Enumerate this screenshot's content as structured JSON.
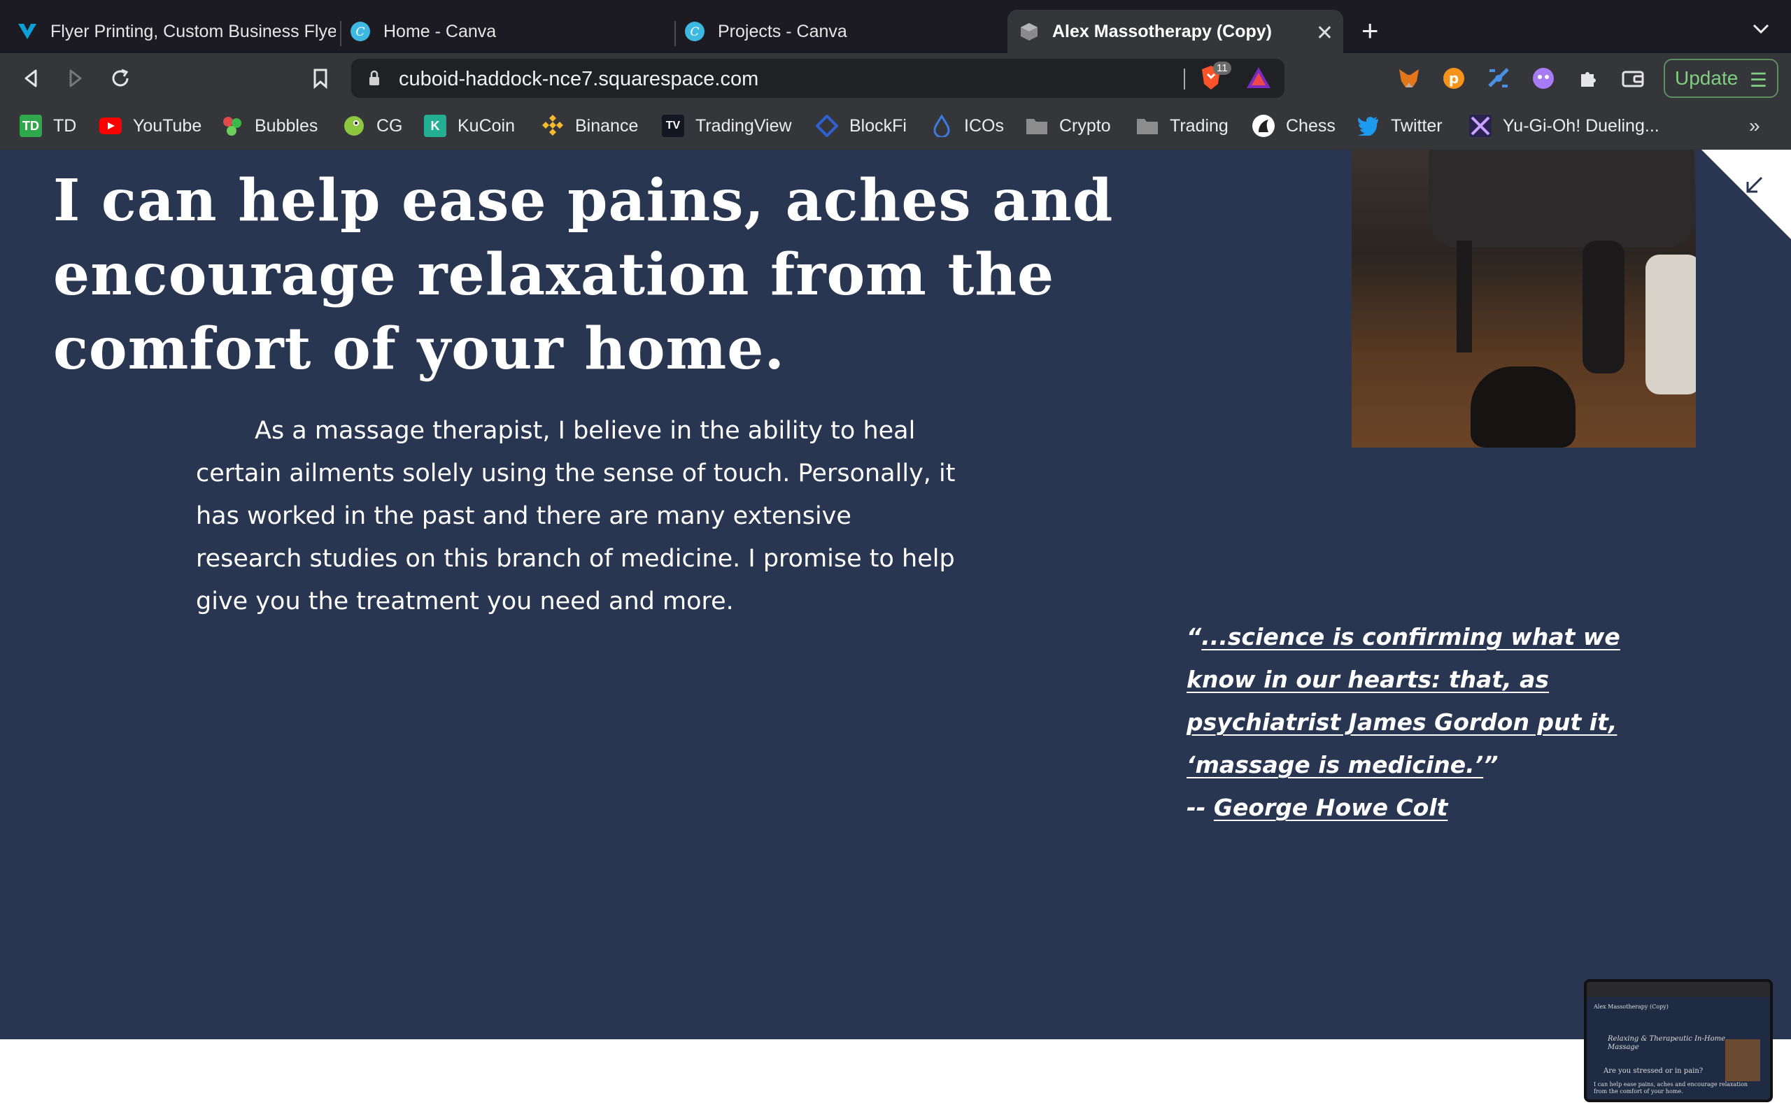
{
  "browser": {
    "tabs": [
      {
        "title": "Flyer Printing, Custom Business Flye",
        "icon": "vistaprint-icon"
      },
      {
        "title": "Home - Canva",
        "icon": "canva-icon"
      },
      {
        "title": "Projects - Canva",
        "icon": "canva-icon"
      },
      {
        "title": "Alex Massotherapy (Copy)",
        "icon": "squarespace-cube-icon",
        "active": true
      }
    ],
    "url": "cuboid-haddock-nce7.squarespace.com",
    "brave_shield_count": "11",
    "update_label": "Update",
    "bookmarks": [
      {
        "label": "TD",
        "icon": "td-icon"
      },
      {
        "label": "YouTube",
        "icon": "youtube-icon"
      },
      {
        "label": "Bubbles",
        "icon": "bubbles-icon"
      },
      {
        "label": "CG",
        "icon": "coingecko-icon"
      },
      {
        "label": "KuCoin",
        "icon": "kucoin-icon"
      },
      {
        "label": "Binance",
        "icon": "binance-icon"
      },
      {
        "label": "TradingView",
        "icon": "tradingview-icon"
      },
      {
        "label": "BlockFi",
        "icon": "blockfi-icon"
      },
      {
        "label": "ICOs",
        "icon": "drop-icon"
      },
      {
        "label": "Crypto",
        "icon": "folder-icon"
      },
      {
        "label": "Trading",
        "icon": "folder-icon"
      },
      {
        "label": "Chess",
        "icon": "chess-icon"
      },
      {
        "label": "Twitter",
        "icon": "twitter-icon"
      },
      {
        "label": "Yu-Gi-Oh! Dueling...",
        "icon": "yugioh-icon"
      }
    ],
    "bookmarks_more": "»"
  },
  "page": {
    "headline": "I can help ease pains, aches and encourage relaxation from the comfort of your home.",
    "body": "As a massage therapist, I believe in the ability to heal certain ailments solely using the sense of touch. Personally, it has worked in the past and there are many extensive research studies on this branch of medicine. I promise to help give you the treatment you need and more.",
    "quote": {
      "open": "“",
      "text": "...science is confirming what we know in our hearts: that, as psychiatrist James Gordon put it, ‘massage is medicine.’",
      "close": "”",
      "dash": "-- ",
      "author": "George Howe Colt"
    },
    "thumbnail": {
      "site_title": "Alex Massotherapy (Copy)",
      "heading": "Relaxing & Therapeutic In-Home Massage",
      "subheading": "Are you stressed or in pain?",
      "line": "I can help ease pains, aches and encourage relaxation from the comfort of your home."
    }
  },
  "colors": {
    "page_bg": "#283651",
    "chrome_bg": "#35363a",
    "tabstrip_bg": "#1c1b22",
    "update_green": "#7fcf7f"
  }
}
